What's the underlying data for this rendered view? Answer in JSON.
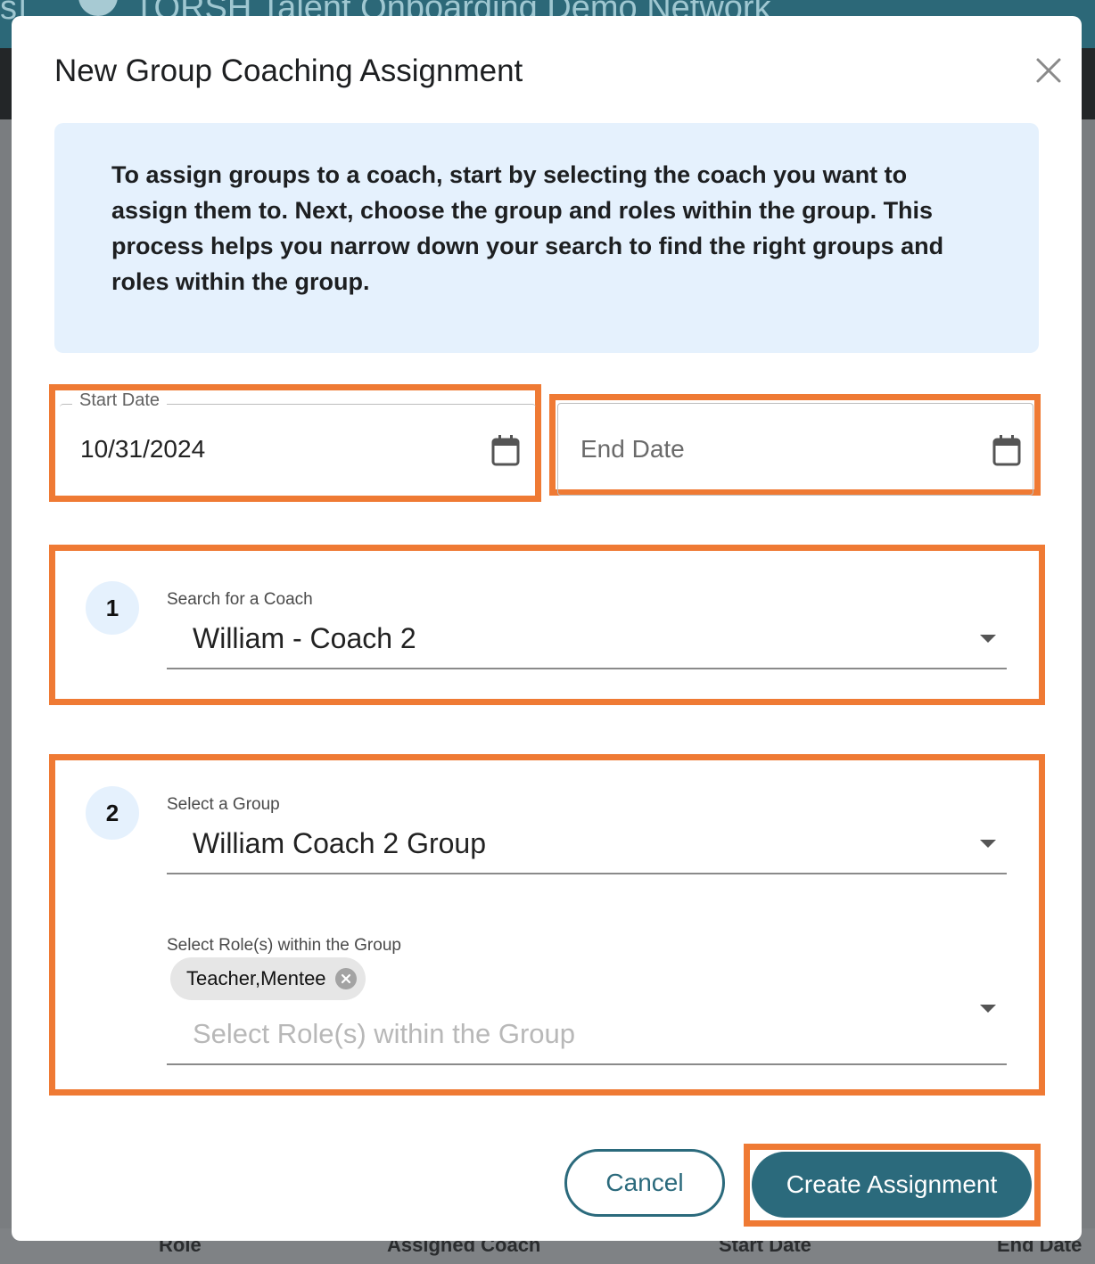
{
  "background": {
    "network_title": "TORSH Talent Onboarding Demo Network",
    "left_fragment": "s]",
    "table_columns": [
      "Role",
      "Assigned Coach",
      "Start Date",
      "End Date"
    ]
  },
  "modal": {
    "title": "New Group Coaching Assignment",
    "info_text": "To assign groups to a coach, start by selecting the coach you want to assign them to. Next, choose the group and roles within the group. This process helps you narrow down your search to find the right groups and roles within the group."
  },
  "start_date": {
    "label": "Start Date",
    "value": "10/31/2024"
  },
  "end_date": {
    "placeholder": "End Date"
  },
  "step1": {
    "number": "1",
    "label": "Search for a Coach",
    "value": "William - Coach 2"
  },
  "step2": {
    "number": "2",
    "group_label": "Select a Group",
    "group_value": "William Coach 2 Group",
    "roles_label": "Select Role(s) within the Group",
    "roles_chip": "Teacher,Mentee",
    "roles_placeholder": "Select Role(s) within the Group"
  },
  "actions": {
    "cancel_label": "Cancel",
    "create_label": "Create Assignment"
  },
  "colors": {
    "accent": "#2b6a7c",
    "highlight": "#ef7a34",
    "info_bg": "#e5f1fd"
  },
  "icons": {
    "close": "close-icon",
    "calendar": "calendar-icon",
    "dropdown": "chevron-down-icon",
    "chip_remove": "remove-chip-icon"
  }
}
